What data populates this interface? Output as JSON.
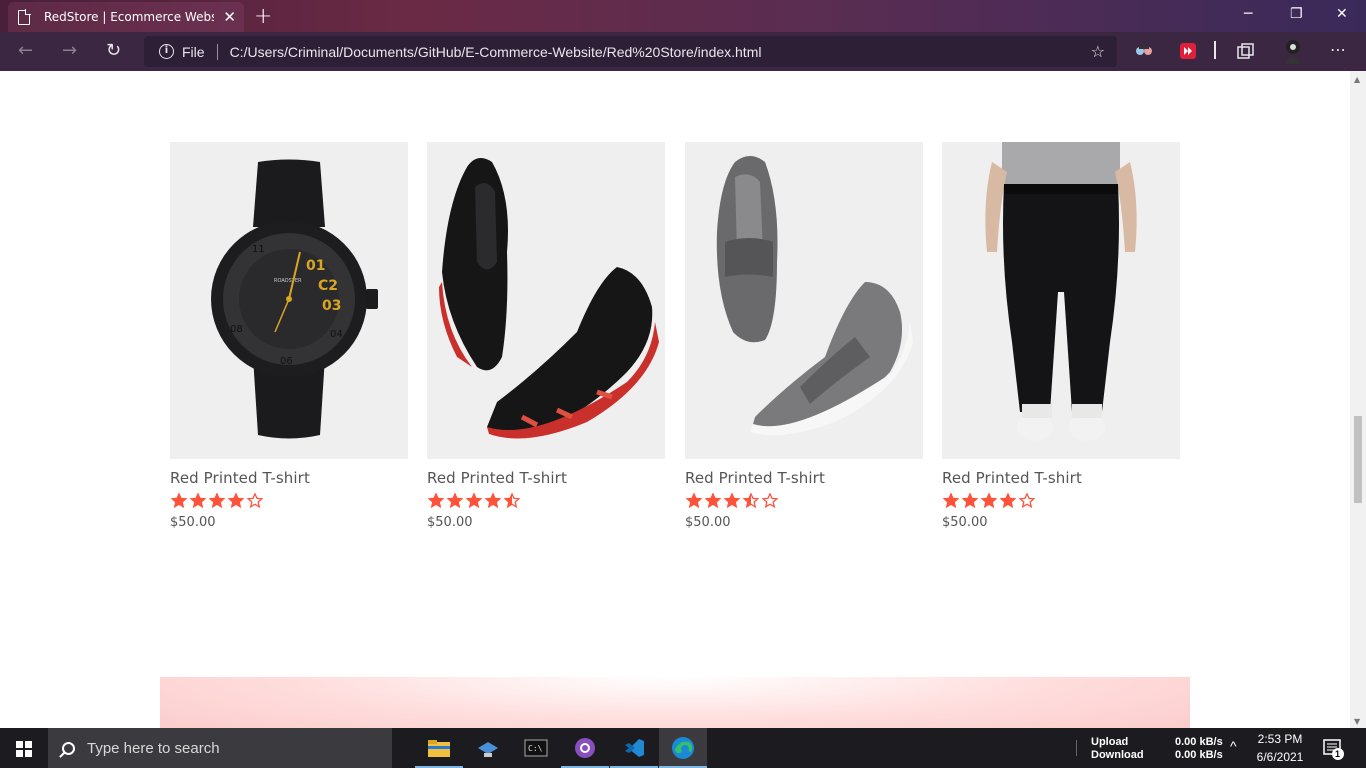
{
  "browser": {
    "tab_title": "RedStore | Ecommerce Website D",
    "file_label": "File",
    "url": "C:/Users/Criminal/Documents/GitHub/E-Commerce-Website/Red%20Store/index.html"
  },
  "products": [
    {
      "name": "Red Printed T-shirt",
      "rating": 4,
      "price": "$50.00",
      "image": "wristwatch"
    },
    {
      "name": "Red Printed T-shirt",
      "rating": 4.5,
      "price": "$50.00",
      "image": "black-red-sneakers"
    },
    {
      "name": "Red Printed T-shirt",
      "rating": 3.5,
      "price": "$50.00",
      "image": "grey-slip-on-shoes"
    },
    {
      "name": "Red Printed T-shirt",
      "rating": 4,
      "price": "$50.00",
      "image": "black-joggers"
    }
  ],
  "colors": {
    "accent": "#ff523b",
    "text": "#555555",
    "card_bg": "#efefef"
  },
  "taskbar": {
    "search_placeholder": "Type here to search",
    "upload_label": "Upload",
    "download_label": "Download",
    "upload_speed": "0.00 kB/s",
    "download_speed": "0.00 kB/s",
    "time": "2:53 PM",
    "date": "6/6/2021",
    "notification_count": "1"
  }
}
